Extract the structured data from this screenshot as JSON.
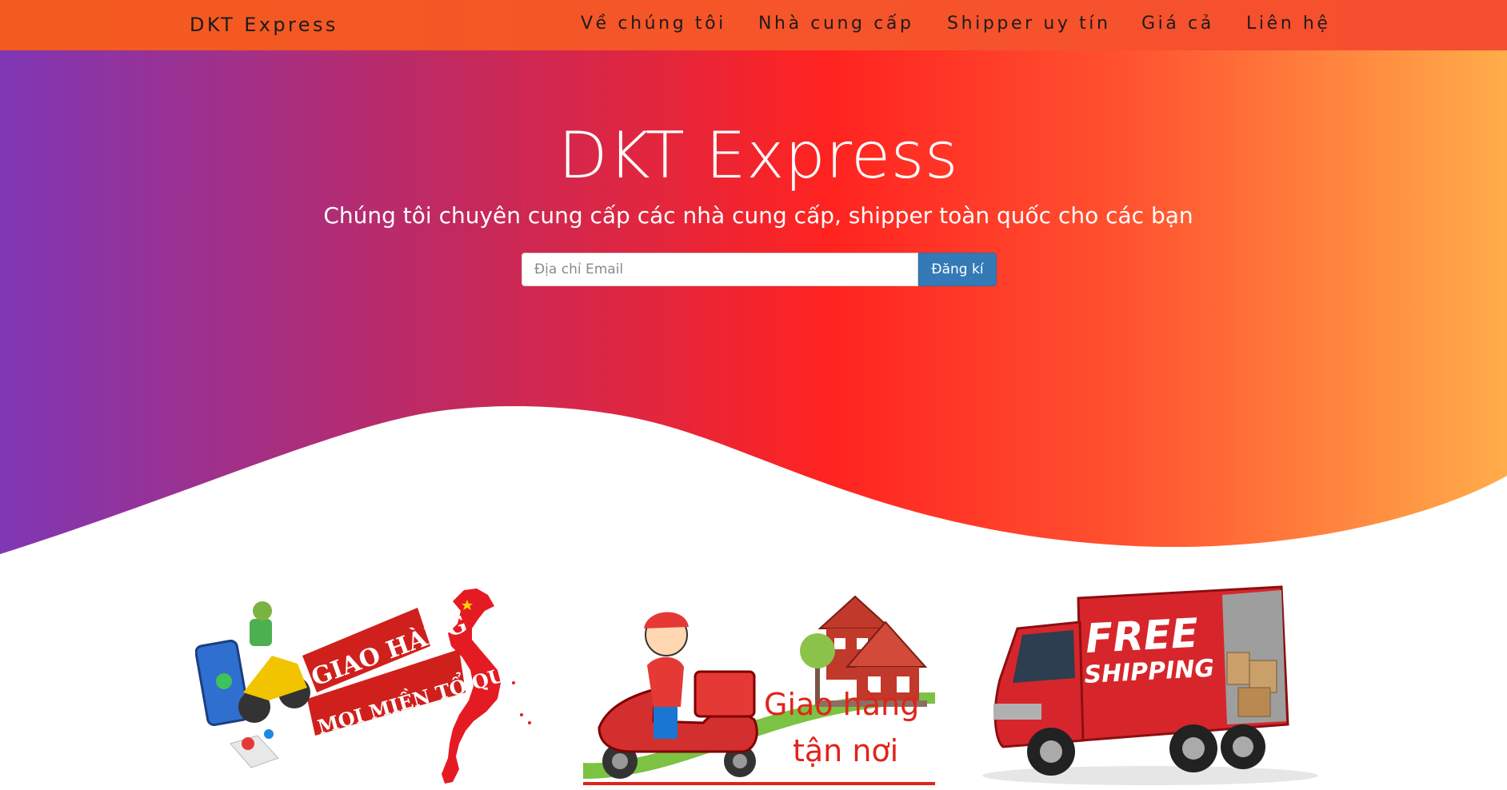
{
  "navbar": {
    "brand": "DKT Express",
    "links": [
      {
        "label": "Về chúng tôi"
      },
      {
        "label": "Nhà cung cấp"
      },
      {
        "label": "Shipper uy tín"
      },
      {
        "label": "Giá cả"
      },
      {
        "label": "Liên hệ"
      }
    ]
  },
  "hero": {
    "title": "DKT Express",
    "subtitle": "Chúng tôi chuyên cung cấp các nhà cung cấp, shipper toàn quốc cho các bạn",
    "email_placeholder": "Địa chỉ Email",
    "email_value": "",
    "signup_label": "Đăng kí"
  },
  "features": [
    {
      "line1": "GIAO HÀNG",
      "line2": "MỌI MIỀN TỔ QUỐC"
    },
    {
      "line1": "Giao hàng",
      "line2": "tận nơi"
    },
    {
      "line1": "FREE",
      "line2": "SHIPPING"
    }
  ],
  "colors": {
    "navbar": "#f35b1f",
    "button": "#337ab7",
    "gradient_start": "#7f37b5",
    "gradient_mid": "#ff2320",
    "gradient_end": "#ffad4a"
  }
}
